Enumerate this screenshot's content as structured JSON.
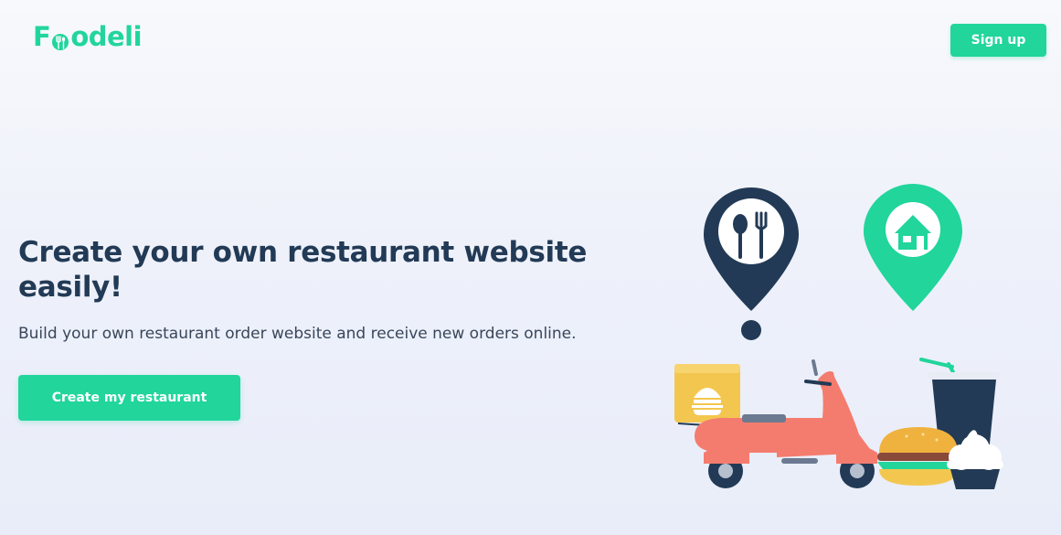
{
  "header": {
    "logo_text_before": "F",
    "logo_text_after": "odeli",
    "signup_label": "Sign up"
  },
  "hero": {
    "headline": "Create your own restaurant website easily!",
    "subtext": "Build your own restaurant order website and receive new orders online.",
    "cta_label": "Create my restaurant"
  },
  "colors": {
    "accent": "#21d59b",
    "navy": "#223a55",
    "scooter": "#f47c6e",
    "box": "#f3c74f"
  },
  "icons": [
    "fork-spoon-icon",
    "fork-icon",
    "restaurant-pin-icon",
    "home-pin-icon",
    "scooter-icon",
    "burger-icon",
    "drink-cup-icon",
    "cupcake-icon"
  ]
}
